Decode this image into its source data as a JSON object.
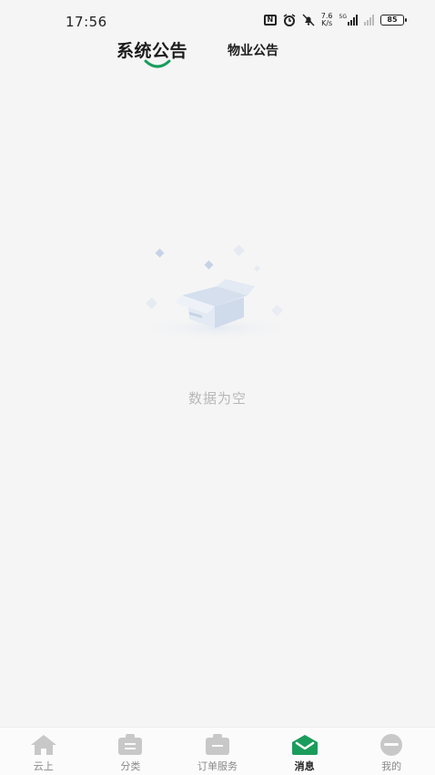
{
  "status_bar": {
    "time": "17:56",
    "nfc": "N",
    "speed_value": "7.6",
    "speed_unit": "K/s",
    "network": "5G",
    "battery": "85"
  },
  "tabs": [
    {
      "label": "系统公告",
      "active": true
    },
    {
      "label": "物业公告",
      "active": false
    }
  ],
  "empty_state": {
    "message": "数据为空"
  },
  "bottom_nav": [
    {
      "label": "云上",
      "icon": "home-icon",
      "active": false
    },
    {
      "label": "分类",
      "icon": "category-icon",
      "active": false
    },
    {
      "label": "订单服务",
      "icon": "order-icon",
      "active": false
    },
    {
      "label": "消息",
      "icon": "message-icon",
      "active": true
    },
    {
      "label": "我的",
      "icon": "profile-icon",
      "active": false
    }
  ],
  "colors": {
    "accent": "#1a9d5c",
    "background": "#f5f5f5",
    "nav_icon_inactive": "#c8c8c8",
    "empty_text": "#b8b8b8"
  }
}
